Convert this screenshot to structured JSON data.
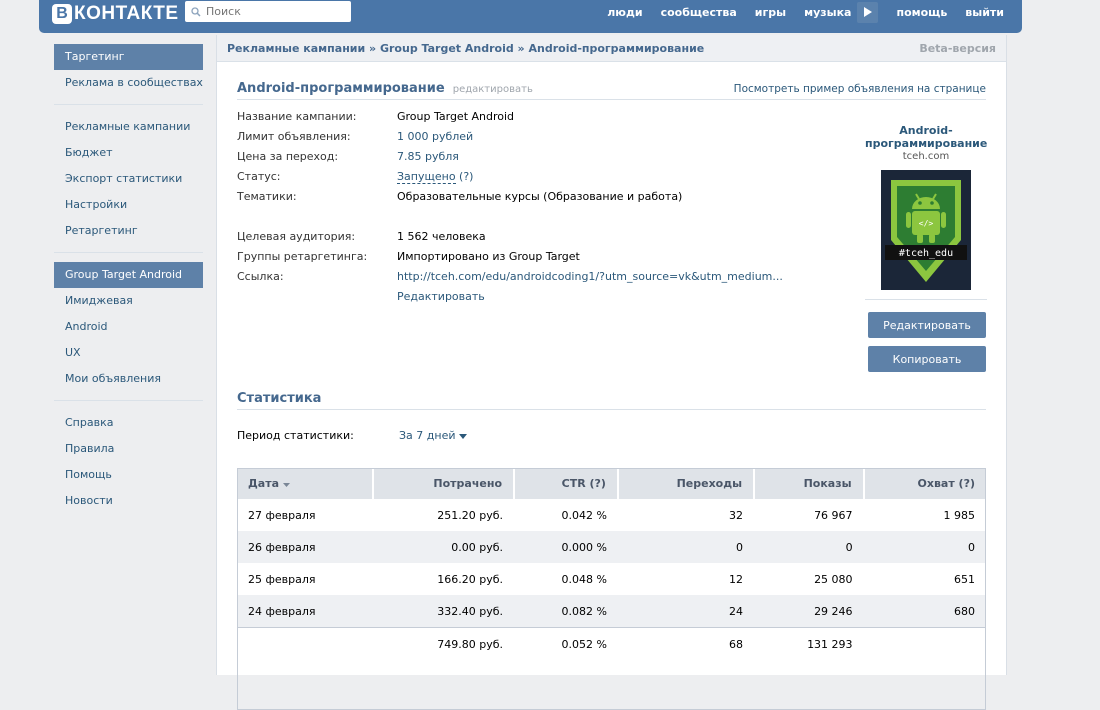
{
  "header": {
    "logo_letter": "В",
    "logo_text": "КОНТАКТЕ",
    "search_placeholder": "Поиск",
    "nav": [
      "люди",
      "сообщества",
      "игры",
      "музыка",
      "помощь",
      "выйти"
    ]
  },
  "sidebar": {
    "group1": [
      "Таргетинг",
      "Реклама в сообществах"
    ],
    "group2": [
      "Рекламные кампании",
      "Бюджет",
      "Экспорт статистики",
      "Настройки",
      "Ретаргетинг"
    ],
    "group3": [
      "Group Target Android",
      "Имиджевая",
      "Android",
      "UX",
      "Мои объявления"
    ],
    "group4": [
      "Справка",
      "Правила",
      "Помощь",
      "Новости"
    ]
  },
  "breadcrumb": {
    "text": "Рекламные кампании » Group Target Android » Android-программирование",
    "beta": "Beta-версия"
  },
  "ad": {
    "title": "Android-программирование",
    "edit_link": "редактировать",
    "preview_link": "Посмотреть пример объявления на странице",
    "props": [
      {
        "label": "Название кампании:",
        "value": "Group Target Android"
      },
      {
        "label": "Лимит объявления:",
        "value": "1 000 рублей"
      },
      {
        "label": "Цена за переход:",
        "value": "7.85 рубля"
      },
      {
        "label": "Статус:",
        "value": "Запущено",
        "hint": "(?)"
      },
      {
        "label": "Тематики:",
        "value": "Образовательные курсы (Образование и работа)"
      },
      {
        "label": "Целевая аудитория:",
        "value": "1 562 человека"
      },
      {
        "label": "Группы ретаргетинга:",
        "value": "Импортировано из Group Target"
      },
      {
        "label": "Ссылка:",
        "value": "http://tceh.com/edu/androidcoding1/?utm_source=vk&utm_medium..."
      },
      {
        "label": "",
        "value": "Редактировать"
      }
    ],
    "preview": {
      "name": "Android-программирование",
      "domain": "tceh.com",
      "image_caption": "#tceh_edu",
      "image_code_glyph": "</>"
    },
    "btn_edit": "Редактировать",
    "btn_copy": "Копировать"
  },
  "stats": {
    "heading": "Статистика",
    "period_label": "Период статистики:",
    "period_value": "За 7 дней",
    "columns": [
      "Дата",
      "Потрачено",
      "CTR (?)",
      "Переходы",
      "Показы",
      "Охват (?)"
    ],
    "rows": [
      [
        "27 февраля",
        "251.20 руб.",
        "0.042 %",
        "32",
        "76 967",
        "1 985"
      ],
      [
        "26 февраля",
        "0.00 руб.",
        "0.000 %",
        "0",
        "0",
        "0"
      ],
      [
        "25 февраля",
        "166.20 руб.",
        "0.048 %",
        "12",
        "25 080",
        "651"
      ],
      [
        "24 февраля",
        "332.40 руб.",
        "0.082 %",
        "24",
        "29 246",
        "680"
      ]
    ],
    "total": [
      "",
      "749.80 руб.",
      "0.052 %",
      "68",
      "131 293",
      ""
    ]
  }
}
